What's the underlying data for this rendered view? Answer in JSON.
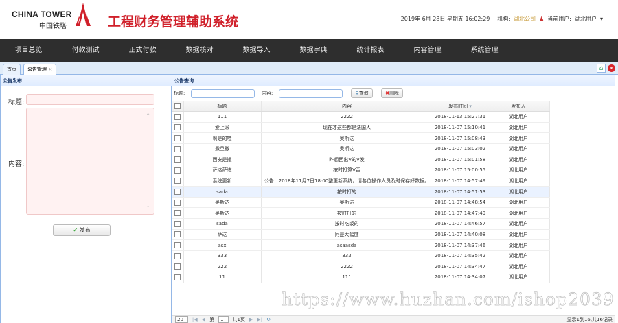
{
  "header": {
    "logo_en": "CHINA TOWER",
    "logo_cn": "中国铁塔",
    "app_title": "工程财务管理辅助系统",
    "datetime": "2019年 6月 28日 星期五 16:02:29",
    "org_label": "机构:",
    "org_value": "湖北公司",
    "user_label": "当前用户:",
    "user_value": "湖北用户"
  },
  "nav": [
    "项目总览",
    "付款测试",
    "正式付款",
    "数据核对",
    "数据导入",
    "数据字典",
    "统计报表",
    "内容管理",
    "系统管理"
  ],
  "tabs": [
    {
      "label": "首页"
    },
    {
      "label": "公告管理",
      "close": "×"
    }
  ],
  "left": {
    "title": "公告发布",
    "title_label": "标题:",
    "content_label": "内容:",
    "title_value": "",
    "content_value": "",
    "publish": "发布"
  },
  "right": {
    "title": "公告查询",
    "search_title_label": "标题:",
    "search_content_label": "内容:",
    "query": "查询",
    "delete": "删除",
    "columns": [
      "标题",
      "内容",
      "发布时间",
      "发布人"
    ],
    "rows": [
      [
        "111",
        "2222",
        "2018-11-13 15:27:31",
        "湖北用户"
      ],
      [
        "爱上滚",
        "现在才这些都是法国人",
        "2018-11-07 15:10:41",
        "湖北用户"
      ],
      [
        "啊是的哇",
        "奥斯达",
        "2018-11-07 15:08:43",
        "湖北用户"
      ],
      [
        "撒旦撒",
        "奥斯达",
        "2018-11-07 15:03:02",
        "湖北用户"
      ],
      [
        "西安是撒",
        "昨想西出V的V发",
        "2018-11-07 15:01:58",
        "湖北用户"
      ],
      [
        "萨达萨达",
        "按时打算V否",
        "2018-11-07 15:00:55",
        "湖北用户"
      ],
      [
        "系统更新",
        "公告：2018年11月7日18:00整更新系统，请各位操作人员及时保存好数据。",
        "2018-11-07 14:57:49",
        "湖北用户"
      ],
      [
        "sada",
        "按时打的",
        "2018-11-07 14:51:53",
        "湖北用户"
      ],
      [
        "奥斯达",
        "奥斯达",
        "2018-11-07 14:48:54",
        "湖北用户"
      ],
      [
        "奥斯达",
        "按时打的",
        "2018-11-07 14:47:49",
        "湖北用户"
      ],
      [
        "sada",
        "按时吃饭的",
        "2018-11-07 14:46:57",
        "湖北用户"
      ],
      [
        "萨达",
        "阿是大幅度",
        "2018-11-07 14:40:08",
        "湖北用户"
      ],
      [
        "asx",
        "asaasda",
        "2018-11-07 14:37:46",
        "湖北用户"
      ],
      [
        "333",
        "333",
        "2018-11-07 14:35:42",
        "湖北用户"
      ],
      [
        "222",
        "2222",
        "2018-11-07 14:34:47",
        "湖北用户"
      ],
      [
        "11",
        "111",
        "2018-11-07 14:34:07",
        "湖北用户"
      ]
    ],
    "selected_row": 7
  },
  "pager": {
    "page_size": "20",
    "page_prefix": "第",
    "page": "1",
    "page_suffix": "共1页",
    "info": "显示1到16,共16记录"
  },
  "watermark": "https://www.huzhan.com/ishop2039"
}
